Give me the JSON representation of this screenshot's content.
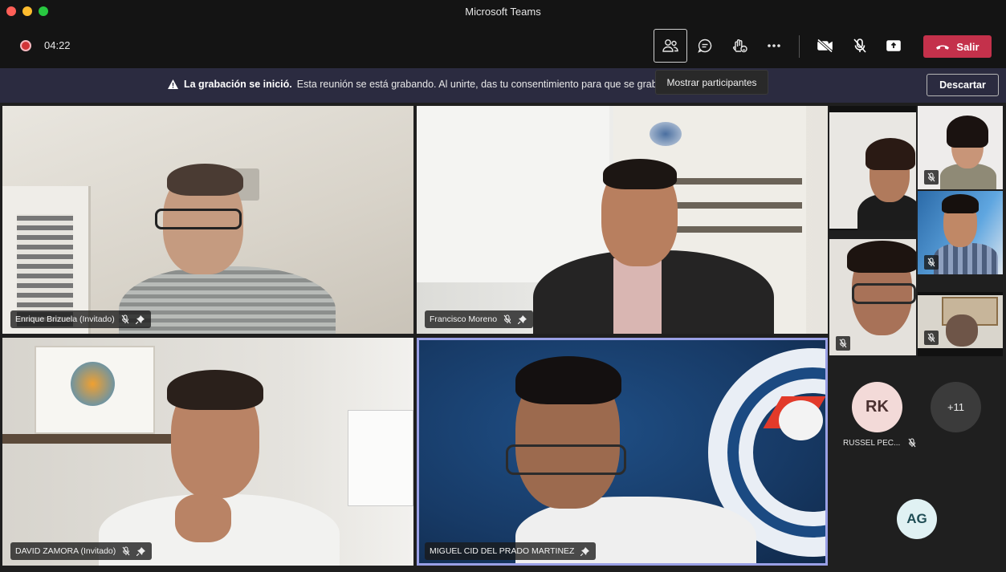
{
  "window": {
    "title": "Microsoft Teams"
  },
  "toolbar": {
    "timer": "04:22",
    "leave_label": "Salir"
  },
  "tooltip": {
    "text": "Mostrar participantes"
  },
  "banner": {
    "title": "La grabación se inició.",
    "message": "Esta reunión se está grabando. Al unirte, das tu consentimiento para que se grabe.",
    "dismiss_label": "Descartar"
  },
  "participants": {
    "p1": {
      "name": "Enrique Brizuela (Invitado)"
    },
    "p2": {
      "name": "Francisco Moreno"
    },
    "p3": {
      "name": "DAVID ZAMORA (Invitado)"
    },
    "p4": {
      "name": "MIGUEL CID DEL PRADO MARTINEZ"
    }
  },
  "sidebar": {
    "rk": {
      "initials": "RK",
      "name": "RUSSEL PEC..."
    },
    "more": {
      "label": "+11"
    },
    "ag": {
      "initials": "AG"
    }
  },
  "colors": {
    "leave": "#c4314b",
    "banner": "#2b2b40",
    "active_speaker_border": "#9aa0e6"
  }
}
